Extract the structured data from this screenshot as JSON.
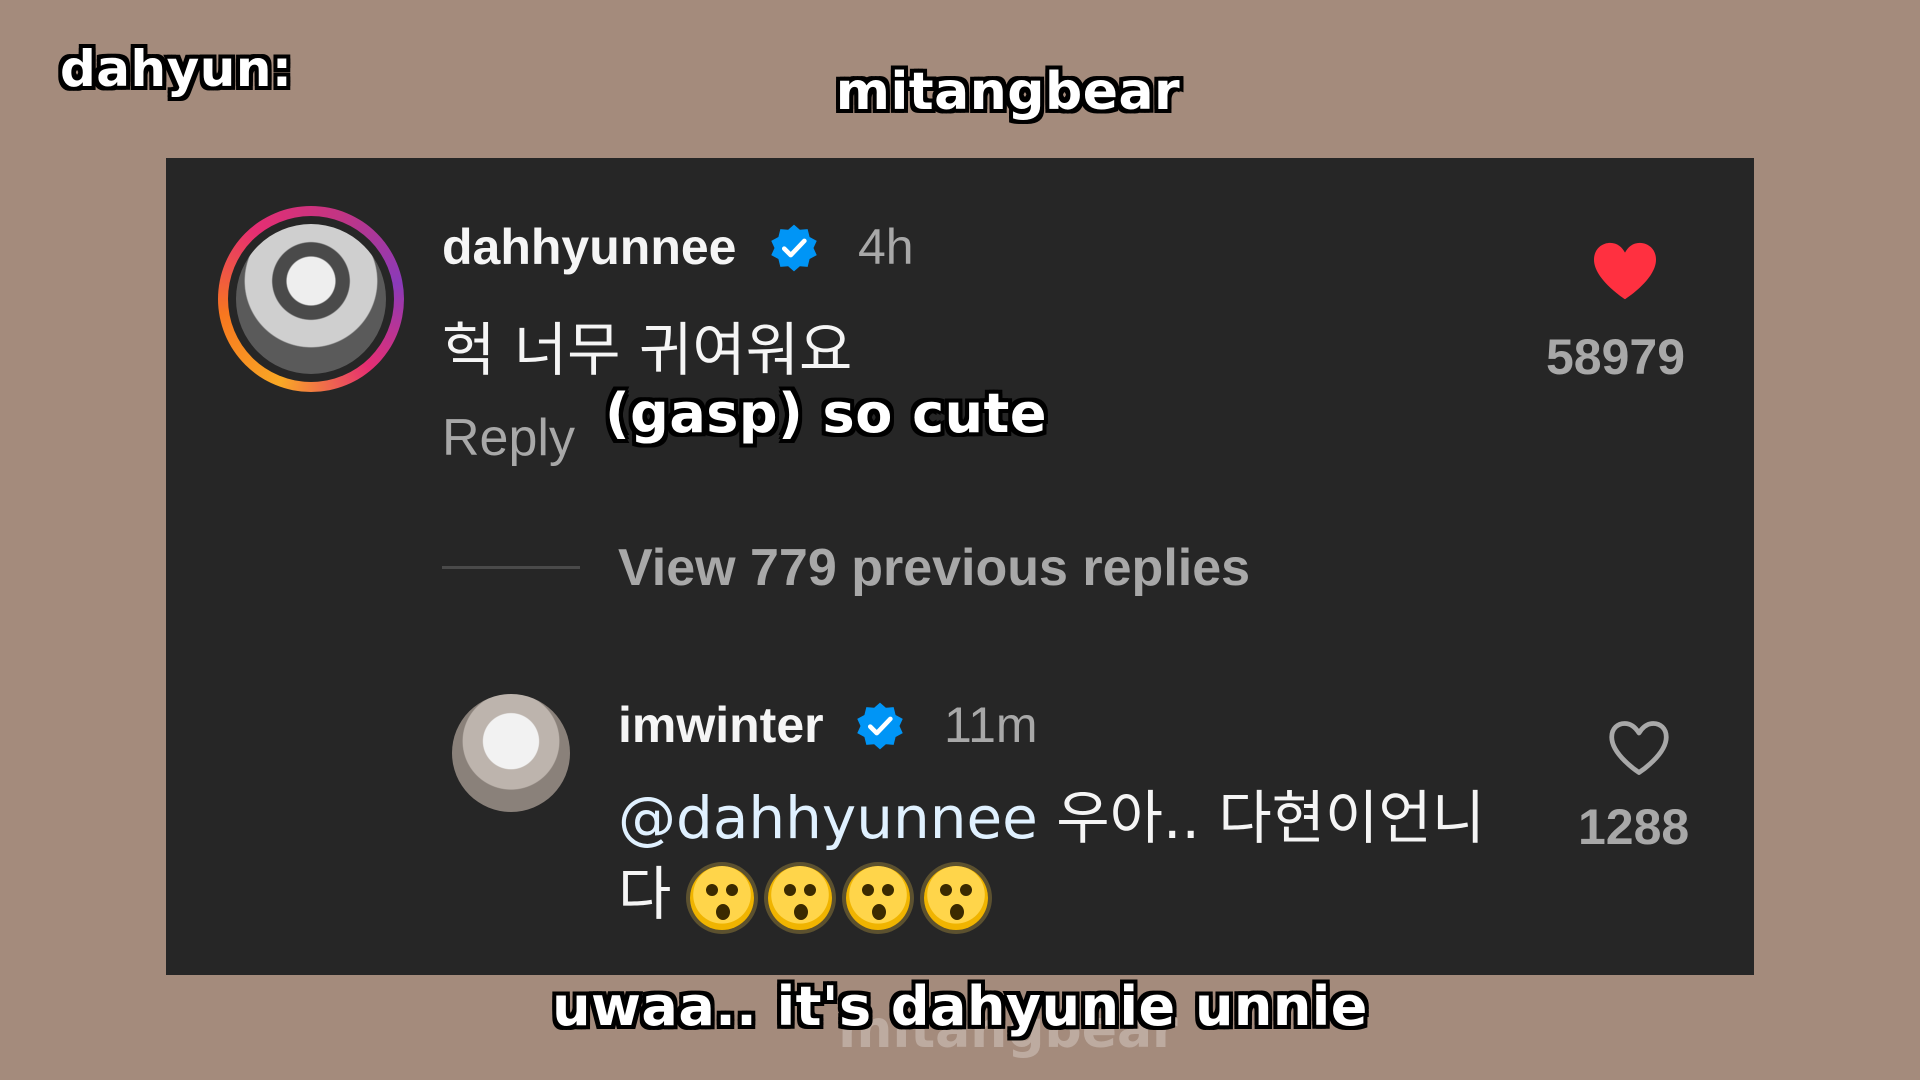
{
  "captions": {
    "speaker": "dahyun:",
    "watermark_top": "mitangbear",
    "subtitle_1": "(gasp) so cute",
    "subtitle_2": "uwaa.. it's dahyunie unnie",
    "watermark_bottom": "mitangbear"
  },
  "comments": [
    {
      "username": "dahhyunnee",
      "verified": true,
      "time": "4h",
      "text": "헉 너무 귀여워요",
      "reply_label": "Reply",
      "likes": "58979",
      "liked": true,
      "heart_color": "#ff3040"
    },
    {
      "username": "imwinter",
      "verified": true,
      "time": "11m",
      "mention": "@dahhyunnee",
      "text": "우아.. 다현이언니다",
      "emoji_icon": "astonished-face-icon",
      "emoji_count": 4,
      "likes": "1288",
      "liked": false
    }
  ],
  "replies_link": "View 779 previous replies",
  "colors": {
    "background": "#a48b7c",
    "panel": "#262626",
    "verified_blue": "#0095f6",
    "text_primary": "#f5f5f5",
    "text_muted": "#a8a8a8"
  }
}
